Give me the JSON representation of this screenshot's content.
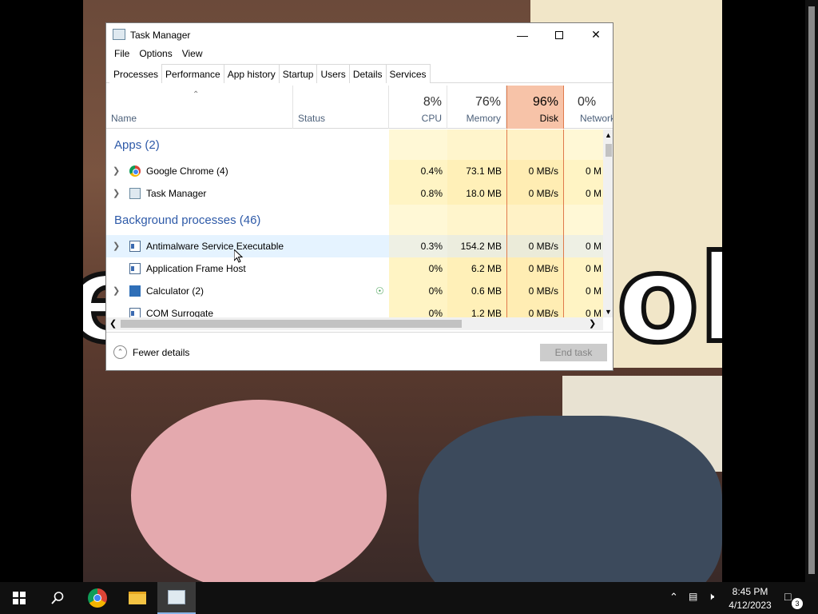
{
  "window": {
    "title": "Task Manager",
    "menu": [
      "File",
      "Options",
      "View"
    ],
    "tabs": [
      "Processes",
      "Performance",
      "App history",
      "Startup",
      "Users",
      "Details",
      "Services"
    ],
    "active_tab": "Processes"
  },
  "columns": {
    "name": "Name",
    "status": "Status",
    "cpu": {
      "pct": "8%",
      "label": "CPU"
    },
    "memory": {
      "pct": "76%",
      "label": "Memory"
    },
    "disk": {
      "pct": "96%",
      "label": "Disk"
    },
    "network": {
      "pct": "0%",
      "label": "Network"
    }
  },
  "groups": {
    "apps": "Apps (2)",
    "background": "Background processes (46)"
  },
  "processes": [
    {
      "name": "Google Chrome (4)",
      "icon": "chrome-icon",
      "cpu": "0.4%",
      "memory": "73.1 MB",
      "disk": "0 MB/s",
      "network": "0 M"
    },
    {
      "name": "Task Manager",
      "icon": "task-manager-icon",
      "cpu": "0.8%",
      "memory": "18.0 MB",
      "disk": "0 MB/s",
      "network": "0 M"
    },
    {
      "name": "Antimalware Service Executable",
      "icon": "app-icon",
      "cpu": "0.3%",
      "memory": "154.2 MB",
      "disk": "0 MB/s",
      "network": "0 M"
    },
    {
      "name": "Application Frame Host",
      "icon": "app-icon",
      "cpu": "0%",
      "memory": "6.2 MB",
      "disk": "0 MB/s",
      "network": "0 M"
    },
    {
      "name": "Calculator (2)",
      "icon": "calculator-icon",
      "cpu": "0%",
      "memory": "0.6 MB",
      "disk": "0 MB/s",
      "network": "0 M"
    },
    {
      "name": "COM Surrogate",
      "icon": "app-icon",
      "cpu": "0%",
      "memory": "1.2 MB",
      "disk": "0 MB/s",
      "network": "0 M"
    }
  ],
  "footer": {
    "fewer_details": "Fewer details",
    "end_task": "End task"
  },
  "taskbar": {
    "time": "8:45 PM",
    "date": "4/12/2023",
    "notification_count": "3"
  },
  "wallpaper_text": {
    "left": "e",
    "right": "old"
  },
  "colors": {
    "disk_highlight": "#f7c3a8",
    "group_title": "#2e5aa8",
    "taskbar": "#101010"
  }
}
